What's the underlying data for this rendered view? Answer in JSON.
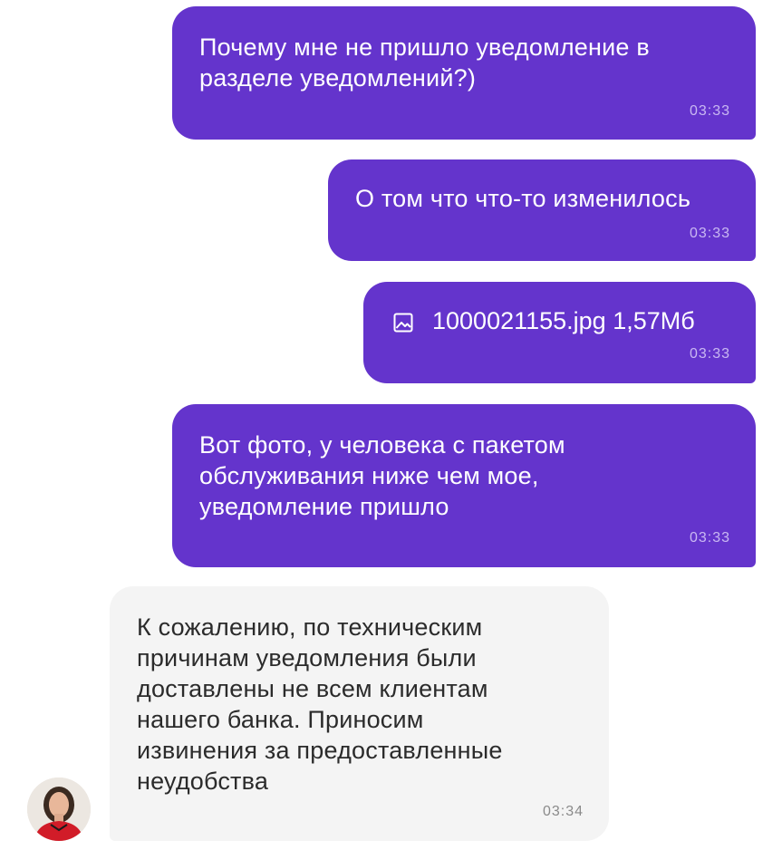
{
  "messages": [
    {
      "direction": "outgoing",
      "text": "Почему мне не пришло уведомление в\nразделе уведомлений?)",
      "time": "03:33"
    },
    {
      "direction": "outgoing",
      "text": "О том что что-то изменилось",
      "time": "03:33"
    },
    {
      "direction": "outgoing",
      "attachment": {
        "icon": "image-file-icon",
        "label": "1000021155.jpg  1,57Мб"
      },
      "time": "03:33"
    },
    {
      "direction": "outgoing",
      "text": "Вот фото, у человека с пакетом\nобслуживания ниже чем мое,\nуведомление пришло",
      "time": "03:33"
    },
    {
      "direction": "incoming",
      "text": "К сожалению, по техническим\nпричинам уведомления были\nдоставлены не всем клиентам\nнашего банка. Приносим\nизвинения за предоставленные\nнеудобства",
      "time": "03:34",
      "avatar": "support-agent-avatar"
    }
  ],
  "colors": {
    "outgoing_bubble": "#6434cc",
    "incoming_bubble": "#f4f4f4",
    "outgoing_text": "#ffffff",
    "incoming_text": "#2b2b2b"
  }
}
